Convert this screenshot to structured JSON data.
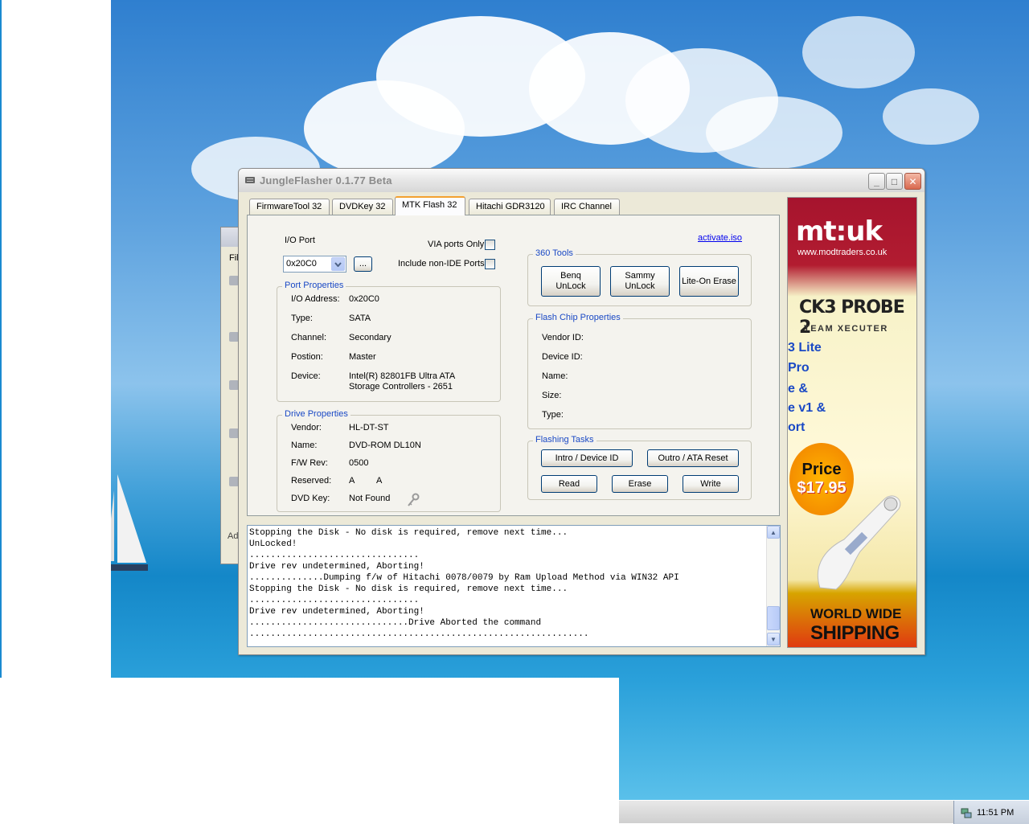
{
  "window": {
    "title": "JungleFlasher 0.1.77 Beta",
    "minimize": "_",
    "maximize": "□",
    "close": "✕"
  },
  "tabs": [
    {
      "label": "FirmwareTool 32"
    },
    {
      "label": "DVDKey 32"
    },
    {
      "label": "MTK Flash 32",
      "active": true
    },
    {
      "label": "Hitachi GDR3120"
    },
    {
      "label": "IRC Channel"
    }
  ],
  "io_port": {
    "label": "I/O Port",
    "selected": "0x20C0",
    "browse_label": "...",
    "via_ports_only": "VIA ports Only",
    "include_non_ide": "Include non-IDE Ports"
  },
  "activate_link": "activate.iso",
  "port_properties": {
    "title": "Port Properties",
    "rows": [
      {
        "label": "I/O Address:",
        "value": "0x20C0"
      },
      {
        "label": "Type:",
        "value": "SATA"
      },
      {
        "label": "Channel:",
        "value": "Secondary"
      },
      {
        "label": "Postion:",
        "value": "Master"
      },
      {
        "label": "Device:",
        "value": "Intel(R) 82801FB Ultra ATA",
        "value2": "Storage Controllers - 2651"
      }
    ]
  },
  "drive_properties": {
    "title": "Drive Properties",
    "rows": [
      {
        "label": "Vendor:",
        "value": "HL-DT-ST"
      },
      {
        "label": "Name:",
        "value": "DVD-ROM DL10N"
      },
      {
        "label": "F/W Rev:",
        "value": "0500"
      },
      {
        "label": "Reserved:",
        "value": "A",
        "value2": "A"
      },
      {
        "label": "DVD Key:",
        "value": "Not Found"
      }
    ]
  },
  "tools_360": {
    "title": "360 Tools",
    "buttons": [
      {
        "line1": "Benq",
        "line2": "UnLock"
      },
      {
        "line1": "Sammy",
        "line2": "UnLock"
      },
      {
        "line1": "Lite-On Erase",
        "line2": ""
      }
    ]
  },
  "flash_chip": {
    "title": "Flash Chip Properties",
    "rows": [
      "Vendor ID:",
      "Device ID:",
      "Name:",
      "Size:",
      "Type:"
    ]
  },
  "flashing_tasks": {
    "title": "Flashing Tasks",
    "intro": "Intro / Device ID",
    "outro": "Outro / ATA Reset",
    "read": "Read",
    "erase": "Erase",
    "write": "Write"
  },
  "log": [
    "Stopping the Disk - No disk is required, remove next time...",
    "UnLocked!",
    "................................",
    "Drive rev undetermined, Aborting!",
    "..............Dumping f/w of Hitachi 0078/0079 by Ram Upload Method via WIN32 API",
    "Stopping the Disk - No disk is required, remove next time...",
    "................................",
    "Drive rev undetermined, Aborting!",
    "..............................Drive Aborted the command",
    "................................................................"
  ],
  "ad": {
    "logo": "mt:uk",
    "url": "www.modtraders.co.uk",
    "product": "CK3 PROBE 2",
    "team": "TEAM XECUTER",
    "lines": [
      "3 Lite",
      " Pro",
      "e &",
      "e v1 &",
      "ort"
    ],
    "badge_label": "Price",
    "badge_price": "$17.95",
    "shipping1": "WORLD WIDE",
    "shipping2": "SHIPPING"
  },
  "background_window": {
    "menu_fragment": "Fil",
    "addr_fragment": "Ad"
  },
  "taskbar": {
    "clock": "11:51 PM"
  },
  "colors": {
    "accent_blue": "#1a49c5",
    "tab_highlight": "#f3a130",
    "ad_red": "#b21c30"
  }
}
